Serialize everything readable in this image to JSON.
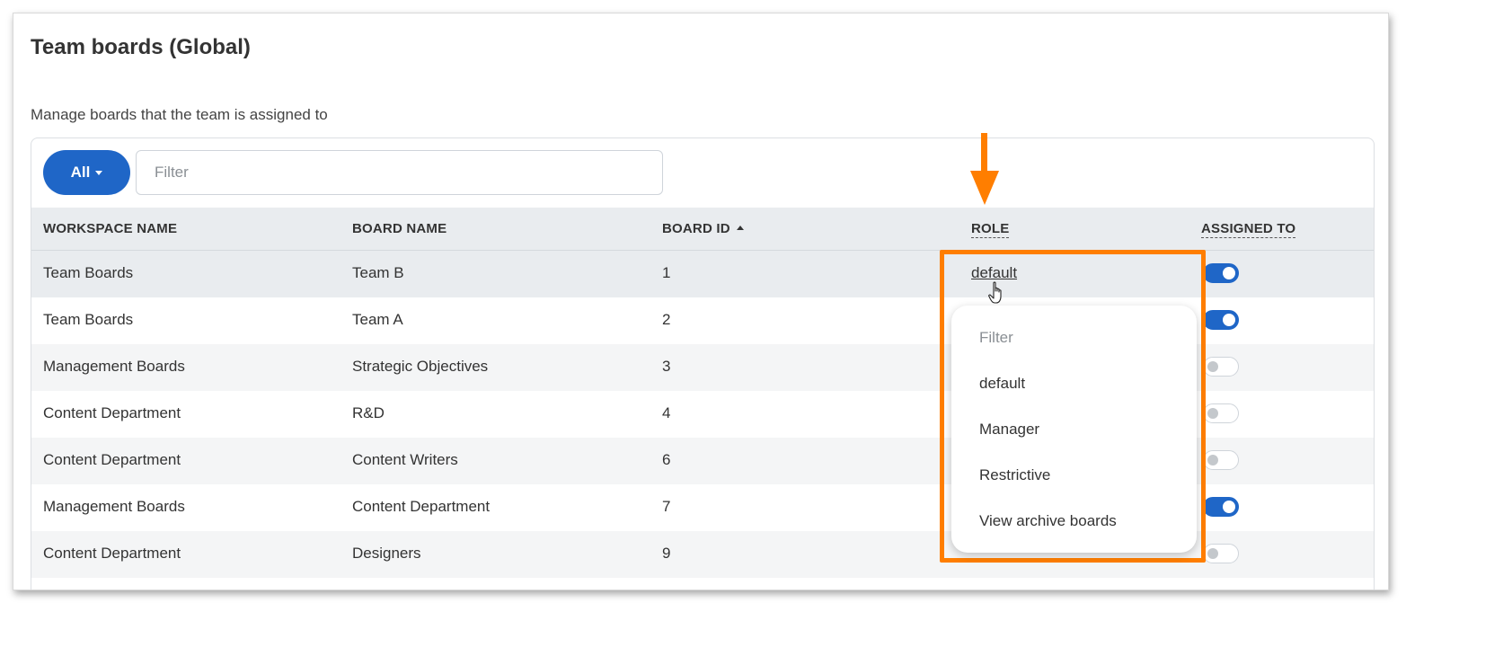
{
  "page": {
    "title": "Team boards (Global)",
    "subtitle": "Manage boards that the team is assigned to"
  },
  "toolbar": {
    "all_label": "All",
    "filter_placeholder": "Filter"
  },
  "table": {
    "columns": {
      "workspace": "WORKSPACE NAME",
      "board": "BOARD NAME",
      "board_id": "BOARD ID",
      "role": "ROLE",
      "assigned_to": "ASSIGNED TO"
    },
    "rows": [
      {
        "workspace": "Team Boards",
        "board": "Team B",
        "id": "1",
        "role": "default",
        "assigned": true
      },
      {
        "workspace": "Team Boards",
        "board": "Team A",
        "id": "2",
        "role": "",
        "assigned": true
      },
      {
        "workspace": "Management Boards",
        "board": "Strategic Objectives",
        "id": "3",
        "role": "",
        "assigned": false
      },
      {
        "workspace": "Content Department",
        "board": "R&D",
        "id": "4",
        "role": "",
        "assigned": false
      },
      {
        "workspace": "Content Department",
        "board": "Content Writers",
        "id": "6",
        "role": "",
        "assigned": false
      },
      {
        "workspace": "Management Boards",
        "board": "Content Department",
        "id": "7",
        "role": "",
        "assigned": true
      },
      {
        "workspace": "Content Department",
        "board": "Designers",
        "id": "9",
        "role": "",
        "assigned": false
      }
    ]
  },
  "role_dropdown": {
    "filter_placeholder": "Filter",
    "options": [
      "default",
      "Manager",
      "Restrictive",
      "View archive boards"
    ]
  },
  "colors": {
    "accent": "#1f66c7",
    "highlight": "#ff7e00"
  }
}
